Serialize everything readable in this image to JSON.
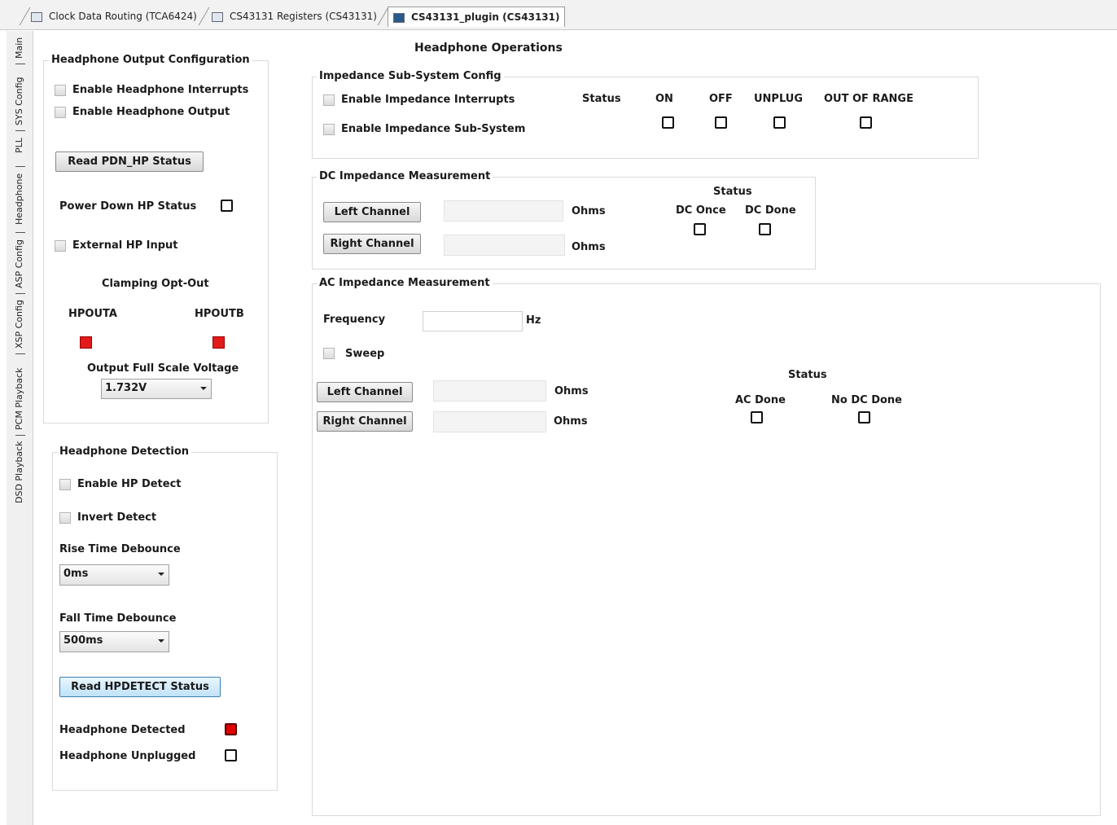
{
  "document_tabs": [
    {
      "label": "Clock Data Routing (TCA6424)",
      "icon": "window-icon"
    },
    {
      "label": "CS43131 Registers (CS43131)",
      "icon": "grid-icon"
    },
    {
      "label": "CS43131_plugin (CS43131)",
      "icon": "plugin-icon",
      "active": true
    }
  ],
  "side_tabs": [
    "Main",
    "SYS Config",
    "PLL",
    "Headphone",
    "ASP Config",
    "XSP Config",
    "PCM Playback",
    "DSD Playback"
  ],
  "page_title": "Headphone Operations",
  "hp_output_config": {
    "title": "Headphone Output Configuration",
    "enable_interrupts": "Enable Headphone Interrupts",
    "enable_output": "Enable Headphone Output",
    "read_button": "Read PDN_HP Status",
    "power_down_status": "Power Down HP Status",
    "external_input": "External HP Input",
    "clamping_title": "Clamping Opt-Out",
    "hpouta": "HPOUTA",
    "hpoutb": "HPOUTB",
    "fs_voltage_label": "Output Full Scale Voltage",
    "fs_voltage_value": "1.732V"
  },
  "hp_detection": {
    "title": "Headphone Detection",
    "enable_detect": "Enable HP Detect",
    "invert_detect": "Invert Detect",
    "rise_label": "Rise Time Debounce",
    "rise_value": "0ms",
    "fall_label": "Fall Time Debounce",
    "fall_value": "500ms",
    "read_button": "Read HPDETECT Status",
    "detected": "Headphone Detected",
    "unplugged": "Headphone Unplugged"
  },
  "impedance_config": {
    "title": "Impedance Sub-System Config",
    "enable_interrupts": "Enable  Impedance Interrupts",
    "enable_subsystem": "Enable Impedance Sub-System",
    "status_label": "Status",
    "on": "ON",
    "off": "OFF",
    "unplug": "UNPLUG",
    "out_of_range": "OUT OF RANGE"
  },
  "dc_measurement": {
    "title": "DC Impedance Measurement",
    "left_button": "Left Channel",
    "right_button": "Right Channel",
    "unit": "Ohms",
    "status_label": "Status",
    "dc_once": "DC Once",
    "dc_done": "DC Done"
  },
  "ac_measurement": {
    "title": "AC Impedance Measurement",
    "frequency_label": "Frequency",
    "frequency_unit": "Hz",
    "sweep": "Sweep",
    "left_button": "Left Channel",
    "right_button": "Right Channel",
    "unit": "Ohms",
    "status_label": "Status",
    "ac_done": "AC Done",
    "no_dc_done": "No DC Done"
  }
}
